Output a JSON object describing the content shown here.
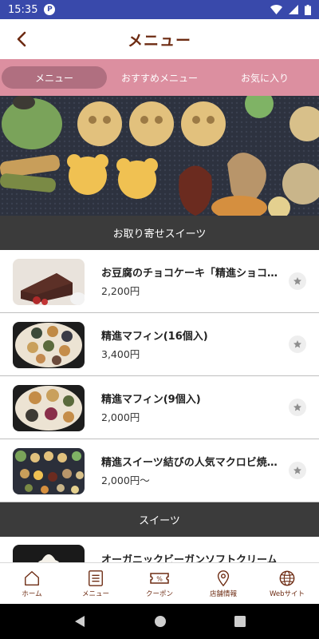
{
  "status_bar": {
    "time": "15:35",
    "notification_glyph": "P"
  },
  "app_bar": {
    "title": "メニュー"
  },
  "tabs": [
    {
      "label": "メニュー",
      "active": true
    },
    {
      "label": "おすすめメニュー",
      "active": false
    },
    {
      "label": "お気に入り",
      "active": false
    }
  ],
  "sections": [
    {
      "title": "お取り寄せスイーツ",
      "items": [
        {
          "name": "お豆腐のチョコケーキ「精進ショコラ」",
          "price": "2,200円"
        },
        {
          "name": "精進マフィン(16個入)",
          "price": "3,400円"
        },
        {
          "name": "精進マフィン(9個入)",
          "price": "2,000円"
        },
        {
          "name": "精進スイーツ結びの人気マクロビ焼き菓子",
          "price": "2,000円〜"
        }
      ]
    },
    {
      "title": "スイーツ",
      "items": [
        {
          "name": "オーガニックビーガンソフトクリーム",
          "price": ""
        }
      ]
    }
  ],
  "bottom_nav": [
    {
      "label": "ホーム",
      "icon": "home-icon"
    },
    {
      "label": "メニュー",
      "icon": "menu-list-icon"
    },
    {
      "label": "クーポン",
      "icon": "coupon-icon"
    },
    {
      "label": "店舗情報",
      "icon": "location-pin-icon"
    },
    {
      "label": "Webサイト",
      "icon": "globe-icon"
    }
  ],
  "colors": {
    "status_bar": "#3949ab",
    "title": "#6d2b12",
    "tab_bar": "#dc8fa0",
    "tab_active": "#b06f80",
    "section_header": "#3b3b3b"
  }
}
